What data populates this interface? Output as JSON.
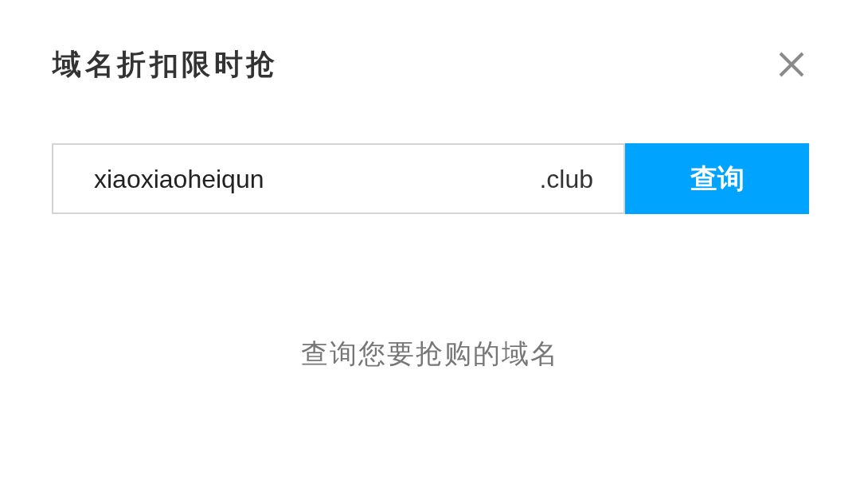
{
  "dialog": {
    "title": "域名折扣限时抢",
    "search": {
      "value": "xiaoxiaoheiqun",
      "suffix": ".club",
      "button": "查询"
    },
    "hint": "查询您要抢购的域名"
  }
}
